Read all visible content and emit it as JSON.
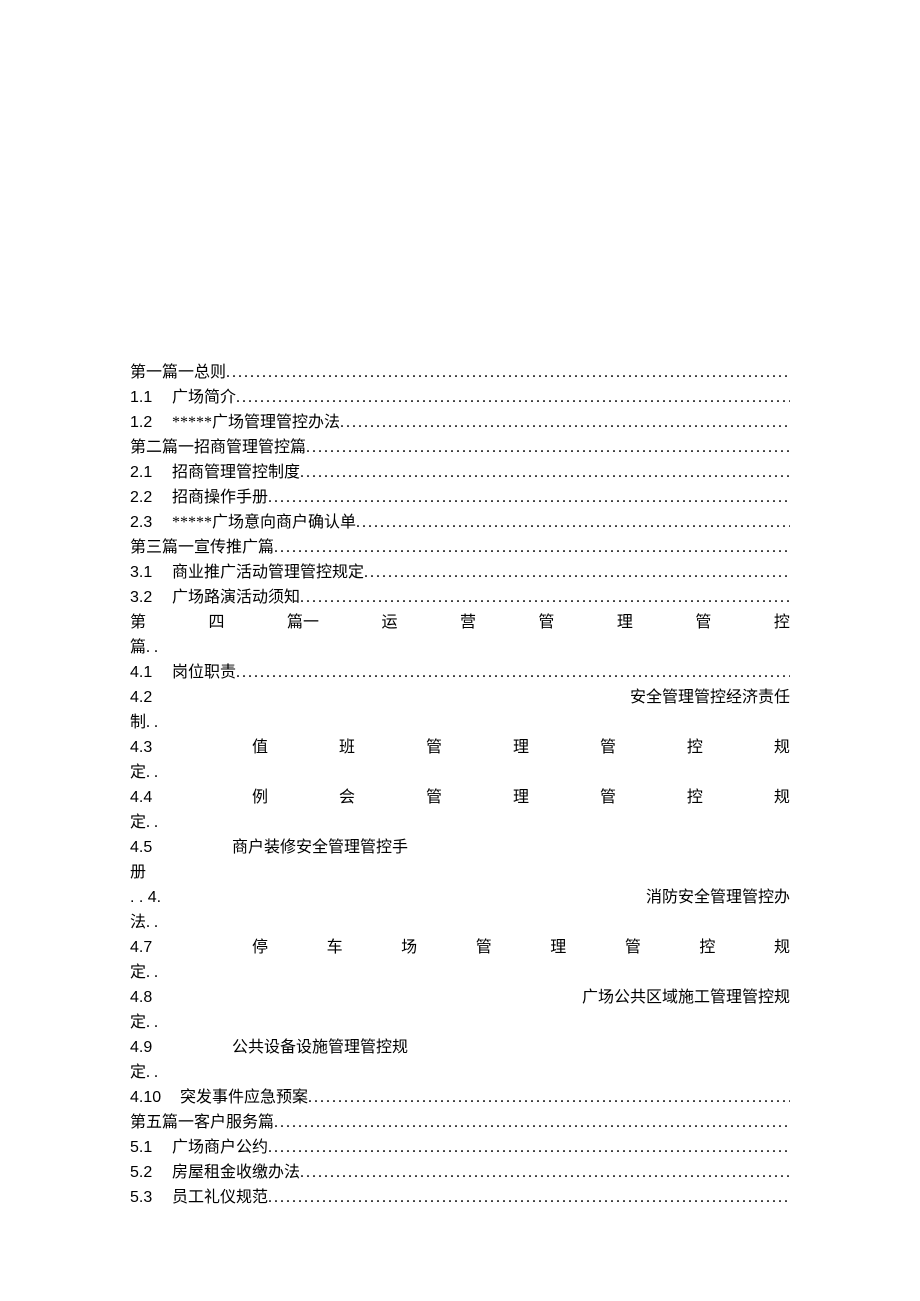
{
  "toc": {
    "p1": {
      "title": "第一篇一总则"
    },
    "i1_1": {
      "num": "1.1",
      "title": "广场简介"
    },
    "i1_2": {
      "num": "1.2",
      "title": "*****广场管理管控办法"
    },
    "p2": {
      "title": "第二篇一招商管理管控篇"
    },
    "i2_1": {
      "num": "2.1",
      "title": "招商管理管控制度"
    },
    "i2_2": {
      "num": "2.2",
      "title": "招商操作手册"
    },
    "i2_3": {
      "num": "2.3",
      "title": "*****广场意向商户确认单"
    },
    "p3": {
      "title": "第三篇一宣传推广篇"
    },
    "i3_1": {
      "num": "3.1",
      "title": "商业推广活动管理管控规定"
    },
    "i3_2": {
      "num": "3.2",
      "title": "广场路演活动须知"
    },
    "p4": {
      "c0": "第",
      "c1": "四",
      "c2": "篇一",
      "c3": "运",
      "c4": "营",
      "c5": "管",
      "c6": "理",
      "c7": "管",
      "c8": "控",
      "tail": "篇. ."
    },
    "i4_1": {
      "num": "4.1",
      "title": "岗位职责"
    },
    "i4_2": {
      "num": "4.2",
      "title": "安全管理管控经济责任",
      "tail": "制. ."
    },
    "i4_3": {
      "num": "4.3",
      "c0": "值",
      "c1": "班",
      "c2": "管",
      "c3": "理",
      "c4": "管",
      "c5": "控",
      "c6": "规",
      "tail": "定. ."
    },
    "i4_4": {
      "num": "4.4",
      "c0": "例",
      "c1": "会",
      "c2": "管",
      "c3": "理",
      "c4": "管",
      "c5": "控",
      "c6": "规",
      "tail": "定. ."
    },
    "i4_5": {
      "num": "4.5",
      "title": "商户装修安全管理管控手",
      "tail": "册"
    },
    "i4_6": {
      "num": ". . 4.",
      "title": "消防安全管理管控办",
      "tail": "法. ."
    },
    "i4_7": {
      "num": "4.7",
      "c0": "停",
      "c1": "车",
      "c2": "场",
      "c3": "管",
      "c4": "理",
      "c5": "管",
      "c6": "控",
      "c7": "规",
      "tail": "定. ."
    },
    "i4_8": {
      "num": "4.8",
      "title": "广场公共区域施工管理管控规",
      "tail": "定. ."
    },
    "i4_9": {
      "num": "4.9",
      "title": "公共设备设施管理管控规",
      "tail": "定. ."
    },
    "i4_10": {
      "num": "4.10",
      "title": "突发事件应急预案"
    },
    "p5": {
      "title": "第五篇一客户服务篇"
    },
    "i5_1": {
      "num": "5.1",
      "title": "广场商户公约"
    },
    "i5_2": {
      "num": "5.2",
      "title": "房屋租金收缴办法"
    },
    "i5_3": {
      "num": "5.3",
      "title": "员工礼仪规范"
    }
  }
}
